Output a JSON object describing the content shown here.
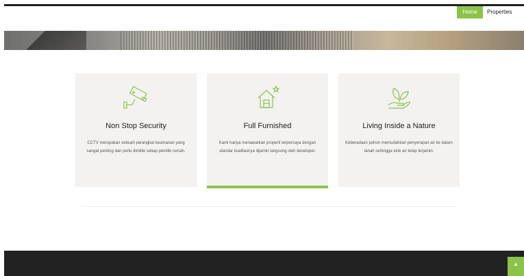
{
  "nav": {
    "home_label": "Home",
    "properties_label": "Properties"
  },
  "features": [
    {
      "title": "Non Stop Security",
      "icon": "cctv-icon",
      "description": "CCTV merupakan sebuah perangkat keamanan yang sangat penting dan perlu dimiliki setiap pemilik rumah."
    },
    {
      "title": "Full Furnished",
      "icon": "house-icon",
      "description": "Kami hanya menawarkan properti terpercaya dengan standar kualitasnya dijamin langsung oleh developer."
    },
    {
      "title": "Living Inside a Nature",
      "icon": "plant-in-hand-icon",
      "description": "Keberadaan pohon memudahkan penyerapan air ke dalam tanah sehingga stok air tetap terjamin."
    }
  ],
  "scroll_top_icon": "chevron-up-icon",
  "colors": {
    "accent": "#8bc34a",
    "card_bg": "#f3f2f0",
    "footer_bg": "#222222"
  }
}
